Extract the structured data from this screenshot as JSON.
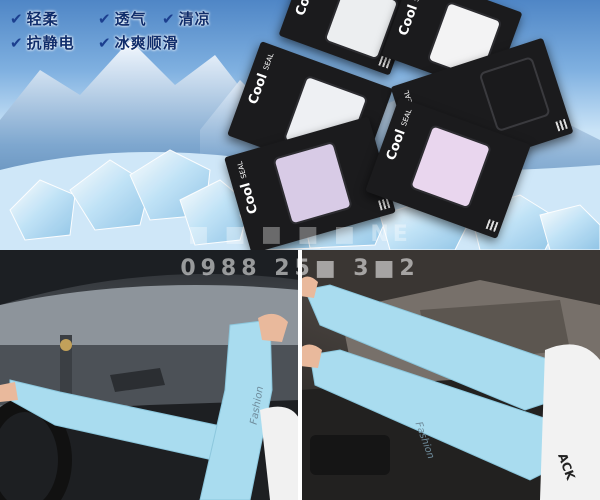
{
  "banner": {
    "features": [
      {
        "label": "轻柔",
        "icon": "check-icon"
      },
      {
        "label": "透气",
        "icon": "check-icon"
      },
      {
        "label": "清凉",
        "icon": "check-icon"
      },
      {
        "label": "抗静电",
        "icon": "check-icon"
      },
      {
        "label": "冰爽顺滑",
        "icon": "check-icon"
      }
    ],
    "check_glyph": "✔",
    "package_brand": "Cool",
    "package_brand_sub": "SEAL",
    "package_colors": [
      "#f1f2f3",
      "#d6c9e6",
      "#e8d4ec",
      "#2b2b2e"
    ]
  },
  "watermark": {
    "phone": "0988 25■ 3■2",
    "site": "■ ■ ■ ■ ■ NE"
  },
  "photos": {
    "sleeve_print": "Fashion",
    "sleeve_color": "#a9dcef"
  }
}
